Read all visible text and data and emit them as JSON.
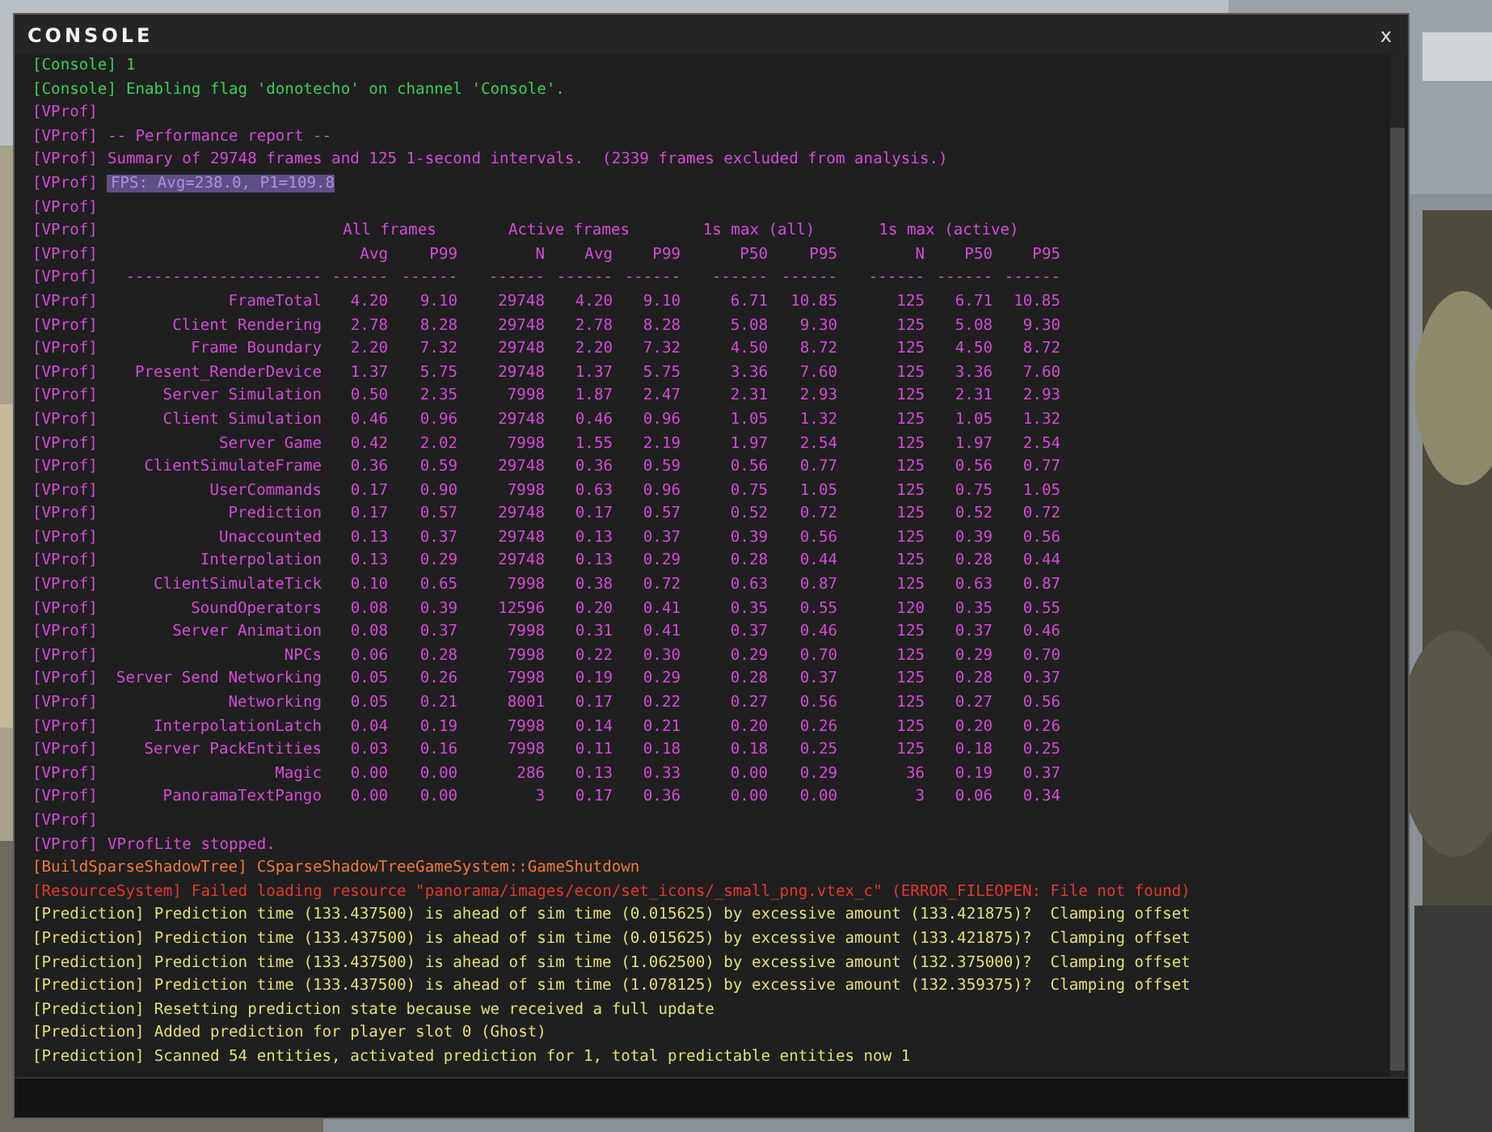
{
  "window": {
    "title": "CONSOLE",
    "close": "x"
  },
  "log_before": [
    {
      "kind": "console",
      "prefix": "[Console]",
      "text": "1",
      "selected": false
    },
    {
      "kind": "console",
      "prefix": "[Console]",
      "text": "Enabling flag 'donotecho' on channel 'Console'.",
      "selected": false
    },
    {
      "kind": "vprof",
      "prefix": "[VProf]",
      "selected": false
    },
    {
      "kind": "vprof",
      "prefix": "[VProf]",
      "text": "-- Performance report --",
      "selected": false
    },
    {
      "kind": "vprof",
      "prefix": "[VProf]",
      "text": "Summary of 29748 frames and 125 1-second intervals.  (2339 frames excluded from analysis.)",
      "selected": false
    },
    {
      "kind": "vprof",
      "prefix": "[VProf]",
      "text": "FPS: Avg=238.0, P1=109.8",
      "selected": true
    },
    {
      "kind": "vprof",
      "prefix": "[VProf]",
      "selected": false
    }
  ],
  "profile_table": {
    "kind": "vprof",
    "group_header": {
      "prefix": "[VProf]",
      "groups": [
        "All frames",
        "Active frames",
        "1s max (all)",
        "1s max (active)"
      ]
    },
    "column_header": {
      "prefix": "[VProf]",
      "columns": [
        "Avg",
        "P99",
        "N",
        "Avg",
        "P99",
        "P50",
        "P95",
        "N",
        "P50",
        "P95"
      ]
    },
    "rule": {
      "prefix": "[VProf]",
      "dashes": [
        "---------------------",
        "------",
        "------",
        "------",
        "------",
        "------",
        "------",
        "------",
        "------",
        "------",
        "------"
      ]
    },
    "rows": [
      {
        "prefix": "[VProf]",
        "name": "FrameTotal",
        "values": [
          "4.20",
          "9.10",
          "29748",
          "4.20",
          "9.10",
          "6.71",
          "10.85",
          "125",
          "6.71",
          "10.85"
        ]
      },
      {
        "prefix": "[VProf]",
        "name": "Client Rendering",
        "values": [
          "2.78",
          "8.28",
          "29748",
          "2.78",
          "8.28",
          "5.08",
          "9.30",
          "125",
          "5.08",
          "9.30"
        ]
      },
      {
        "prefix": "[VProf]",
        "name": "Frame Boundary",
        "values": [
          "2.20",
          "7.32",
          "29748",
          "2.20",
          "7.32",
          "4.50",
          "8.72",
          "125",
          "4.50",
          "8.72"
        ]
      },
      {
        "prefix": "[VProf]",
        "name": "Present_RenderDevice",
        "values": [
          "1.37",
          "5.75",
          "29748",
          "1.37",
          "5.75",
          "3.36",
          "7.60",
          "125",
          "3.36",
          "7.60"
        ]
      },
      {
        "prefix": "[VProf]",
        "name": "Server Simulation",
        "values": [
          "0.50",
          "2.35",
          "7998",
          "1.87",
          "2.47",
          "2.31",
          "2.93",
          "125",
          "2.31",
          "2.93"
        ]
      },
      {
        "prefix": "[VProf]",
        "name": "Client Simulation",
        "values": [
          "0.46",
          "0.96",
          "29748",
          "0.46",
          "0.96",
          "1.05",
          "1.32",
          "125",
          "1.05",
          "1.32"
        ]
      },
      {
        "prefix": "[VProf]",
        "name": "Server Game",
        "values": [
          "0.42",
          "2.02",
          "7998",
          "1.55",
          "2.19",
          "1.97",
          "2.54",
          "125",
          "1.97",
          "2.54"
        ]
      },
      {
        "prefix": "[VProf]",
        "name": "ClientSimulateFrame",
        "values": [
          "0.36",
          "0.59",
          "29748",
          "0.36",
          "0.59",
          "0.56",
          "0.77",
          "125",
          "0.56",
          "0.77"
        ]
      },
      {
        "prefix": "[VProf]",
        "name": "UserCommands",
        "values": [
          "0.17",
          "0.90",
          "7998",
          "0.63",
          "0.96",
          "0.75",
          "1.05",
          "125",
          "0.75",
          "1.05"
        ]
      },
      {
        "prefix": "[VProf]",
        "name": "Prediction",
        "values": [
          "0.17",
          "0.57",
          "29748",
          "0.17",
          "0.57",
          "0.52",
          "0.72",
          "125",
          "0.52",
          "0.72"
        ]
      },
      {
        "prefix": "[VProf]",
        "name": "Unaccounted",
        "values": [
          "0.13",
          "0.37",
          "29748",
          "0.13",
          "0.37",
          "0.39",
          "0.56",
          "125",
          "0.39",
          "0.56"
        ]
      },
      {
        "prefix": "[VProf]",
        "name": "Interpolation",
        "values": [
          "0.13",
          "0.29",
          "29748",
          "0.13",
          "0.29",
          "0.28",
          "0.44",
          "125",
          "0.28",
          "0.44"
        ]
      },
      {
        "prefix": "[VProf]",
        "name": "ClientSimulateTick",
        "values": [
          "0.10",
          "0.65",
          "7998",
          "0.38",
          "0.72",
          "0.63",
          "0.87",
          "125",
          "0.63",
          "0.87"
        ]
      },
      {
        "prefix": "[VProf]",
        "name": "SoundOperators",
        "values": [
          "0.08",
          "0.39",
          "12596",
          "0.20",
          "0.41",
          "0.35",
          "0.55",
          "120",
          "0.35",
          "0.55"
        ]
      },
      {
        "prefix": "[VProf]",
        "name": "Server Animation",
        "values": [
          "0.08",
          "0.37",
          "7998",
          "0.31",
          "0.41",
          "0.37",
          "0.46",
          "125",
          "0.37",
          "0.46"
        ]
      },
      {
        "prefix": "[VProf]",
        "name": "NPCs",
        "values": [
          "0.06",
          "0.28",
          "7998",
          "0.22",
          "0.30",
          "0.29",
          "0.70",
          "125",
          "0.29",
          "0.70"
        ]
      },
      {
        "prefix": "[VProf]",
        "name": "Server Send Networking",
        "values": [
          "0.05",
          "0.26",
          "7998",
          "0.19",
          "0.29",
          "0.28",
          "0.37",
          "125",
          "0.28",
          "0.37"
        ]
      },
      {
        "prefix": "[VProf]",
        "name": "Networking",
        "values": [
          "0.05",
          "0.21",
          "8001",
          "0.17",
          "0.22",
          "0.27",
          "0.56",
          "125",
          "0.27",
          "0.56"
        ]
      },
      {
        "prefix": "[VProf]",
        "name": "InterpolationLatch",
        "values": [
          "0.04",
          "0.19",
          "7998",
          "0.14",
          "0.21",
          "0.20",
          "0.26",
          "125",
          "0.20",
          "0.26"
        ]
      },
      {
        "prefix": "[VProf]",
        "name": "Server PackEntities",
        "values": [
          "0.03",
          "0.16",
          "7998",
          "0.11",
          "0.18",
          "0.18",
          "0.25",
          "125",
          "0.18",
          "0.25"
        ]
      },
      {
        "prefix": "[VProf]",
        "name": "Magic",
        "values": [
          "0.00",
          "0.00",
          "286",
          "0.13",
          "0.33",
          "0.00",
          "0.29",
          "36",
          "0.19",
          "0.37"
        ]
      },
      {
        "prefix": "[VProf]",
        "name": "PanoramaTextPango",
        "values": [
          "0.00",
          "0.00",
          "3",
          "0.17",
          "0.36",
          "0.00",
          "0.00",
          "3",
          "0.06",
          "0.34"
        ]
      }
    ]
  },
  "log_after": [
    {
      "kind": "vprof",
      "prefix": "[VProf]",
      "selected": false
    },
    {
      "kind": "vprof",
      "prefix": "[VProf]",
      "text": "VProfLite stopped.",
      "selected": false
    },
    {
      "kind": "build",
      "prefix": "[BuildSparseShadowTree]",
      "text": "CSparseShadowTreeGameSystem::GameShutdown",
      "selected": false
    },
    {
      "kind": "resource",
      "prefix": "[ResourceSystem]",
      "text": "Failed loading resource \"panorama/images/econ/set_icons/_small_png.vtex_c\" (ERROR_FILEOPEN: File not found)",
      "selected": false
    },
    {
      "kind": "prediction",
      "prefix": "[Prediction]",
      "text": "Prediction time (133.437500) is ahead of sim time (0.015625) by excessive amount (133.421875)?  Clamping offset",
      "selected": false
    },
    {
      "kind": "prediction",
      "prefix": "[Prediction]",
      "text": "Prediction time (133.437500) is ahead of sim time (0.015625) by excessive amount (133.421875)?  Clamping offset",
      "selected": false
    },
    {
      "kind": "prediction",
      "prefix": "[Prediction]",
      "text": "Prediction time (133.437500) is ahead of sim time (1.062500) by excessive amount (132.375000)?  Clamping offset",
      "selected": false
    },
    {
      "kind": "prediction",
      "prefix": "[Prediction]",
      "text": "Prediction time (133.437500) is ahead of sim time (1.078125) by excessive amount (132.359375)?  Clamping offset",
      "selected": false
    },
    {
      "kind": "prediction",
      "prefix": "[Prediction]",
      "text": "Resetting prediction state because we received a full update",
      "selected": false
    },
    {
      "kind": "prediction",
      "prefix": "[Prediction]",
      "text": "Added prediction for player slot 0 (Ghost)",
      "selected": false
    },
    {
      "kind": "prediction",
      "prefix": "[Prediction]",
      "text": "Scanned 54 entities, activated prediction for 1, total predictable entities now 1",
      "selected": false
    }
  ]
}
